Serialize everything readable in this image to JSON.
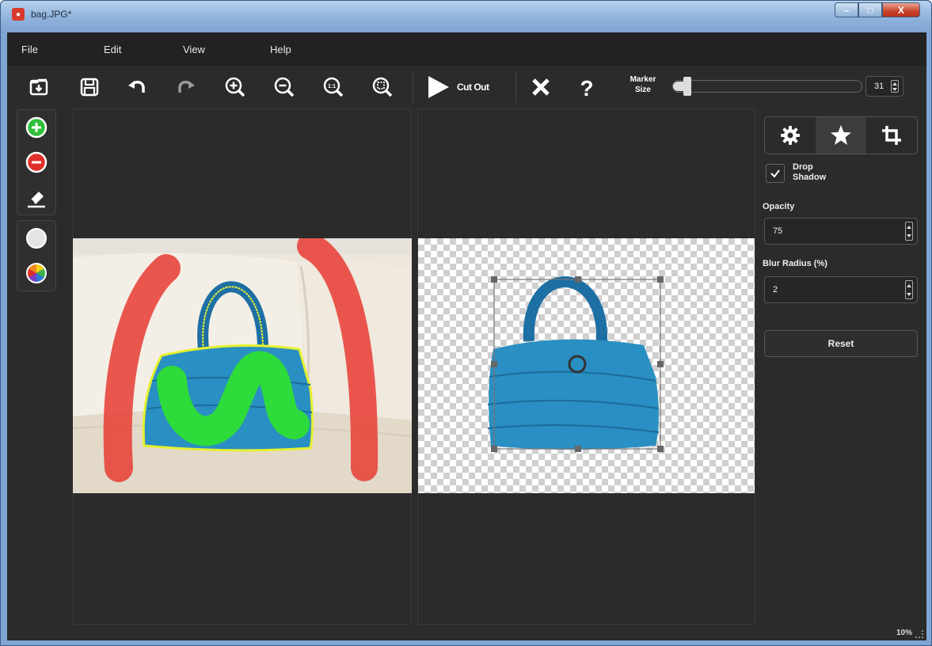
{
  "window": {
    "title": "bag.JPG*",
    "controls": {
      "minimize": "–",
      "maximize": "□",
      "close": "X"
    }
  },
  "menu": {
    "items": [
      "File",
      "Edit",
      "View",
      "Help"
    ]
  },
  "toolbar": {
    "icons": [
      "open-icon",
      "save-icon",
      "undo-icon",
      "redo-icon",
      "zoom-in-icon",
      "zoom-out-icon",
      "zoom-actual-icon",
      "zoom-fit-icon"
    ],
    "cut_out_label": "Cut Out",
    "marker_size_label": "Marker Size",
    "marker_size_value": "31",
    "marker_size_level": 0.07
  },
  "left_tools": {
    "mark_tools": [
      "add-foreground-icon",
      "mark-background-icon",
      "eraser-icon"
    ],
    "view_tools": [
      "background-color-icon",
      "color-wheel-icon"
    ]
  },
  "settings_panel": {
    "tabs": [
      "settings-icon",
      "star-icon",
      "crop-icon"
    ],
    "active_tab": 1,
    "drop_shadow_label": "Drop Shadow",
    "drop_shadow_checked": true,
    "opacity_label": "Opacity",
    "opacity_value": "75",
    "blur_label": "Blur Radius (%)",
    "blur_value": "2",
    "reset_label": "Reset"
  },
  "status": {
    "zoom": "10%"
  },
  "colors": {
    "background_marker": "#e8453c",
    "foreground_marker": "#2ddc3a",
    "outline": "#e6f030",
    "bag": "#2a8fc2"
  }
}
